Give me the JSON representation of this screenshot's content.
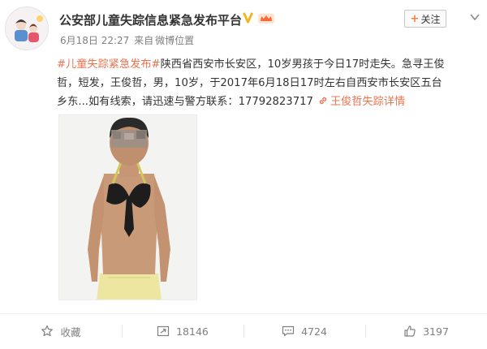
{
  "post": {
    "author": "公安部儿童失踪信息紧急发布平台",
    "date": "6月18日 22:27",
    "source_prefix": "来自",
    "source": "微博位置",
    "follow_label": "关注",
    "topic": "#儿童失踪紧急发布#",
    "line1_rest": "陕西省西安市长安区，10岁男孩于今日17时走失。急寻王俊",
    "line2": "哲，短发，王俊哲，男，10岁，于2017年6月18日17时左右自西安市长安区五台",
    "line3_text": "乡东...如有线索，请迅速与警方联系：17792823717",
    "link_text": "王俊哲失踪详情"
  },
  "actions": {
    "favorite_label": "收藏",
    "repost_count": "18146",
    "comment_count": "4724",
    "like_count": "3197"
  },
  "colors": {
    "accent": "#eb7350",
    "verified": "#f6b318",
    "muted": "#808080"
  }
}
